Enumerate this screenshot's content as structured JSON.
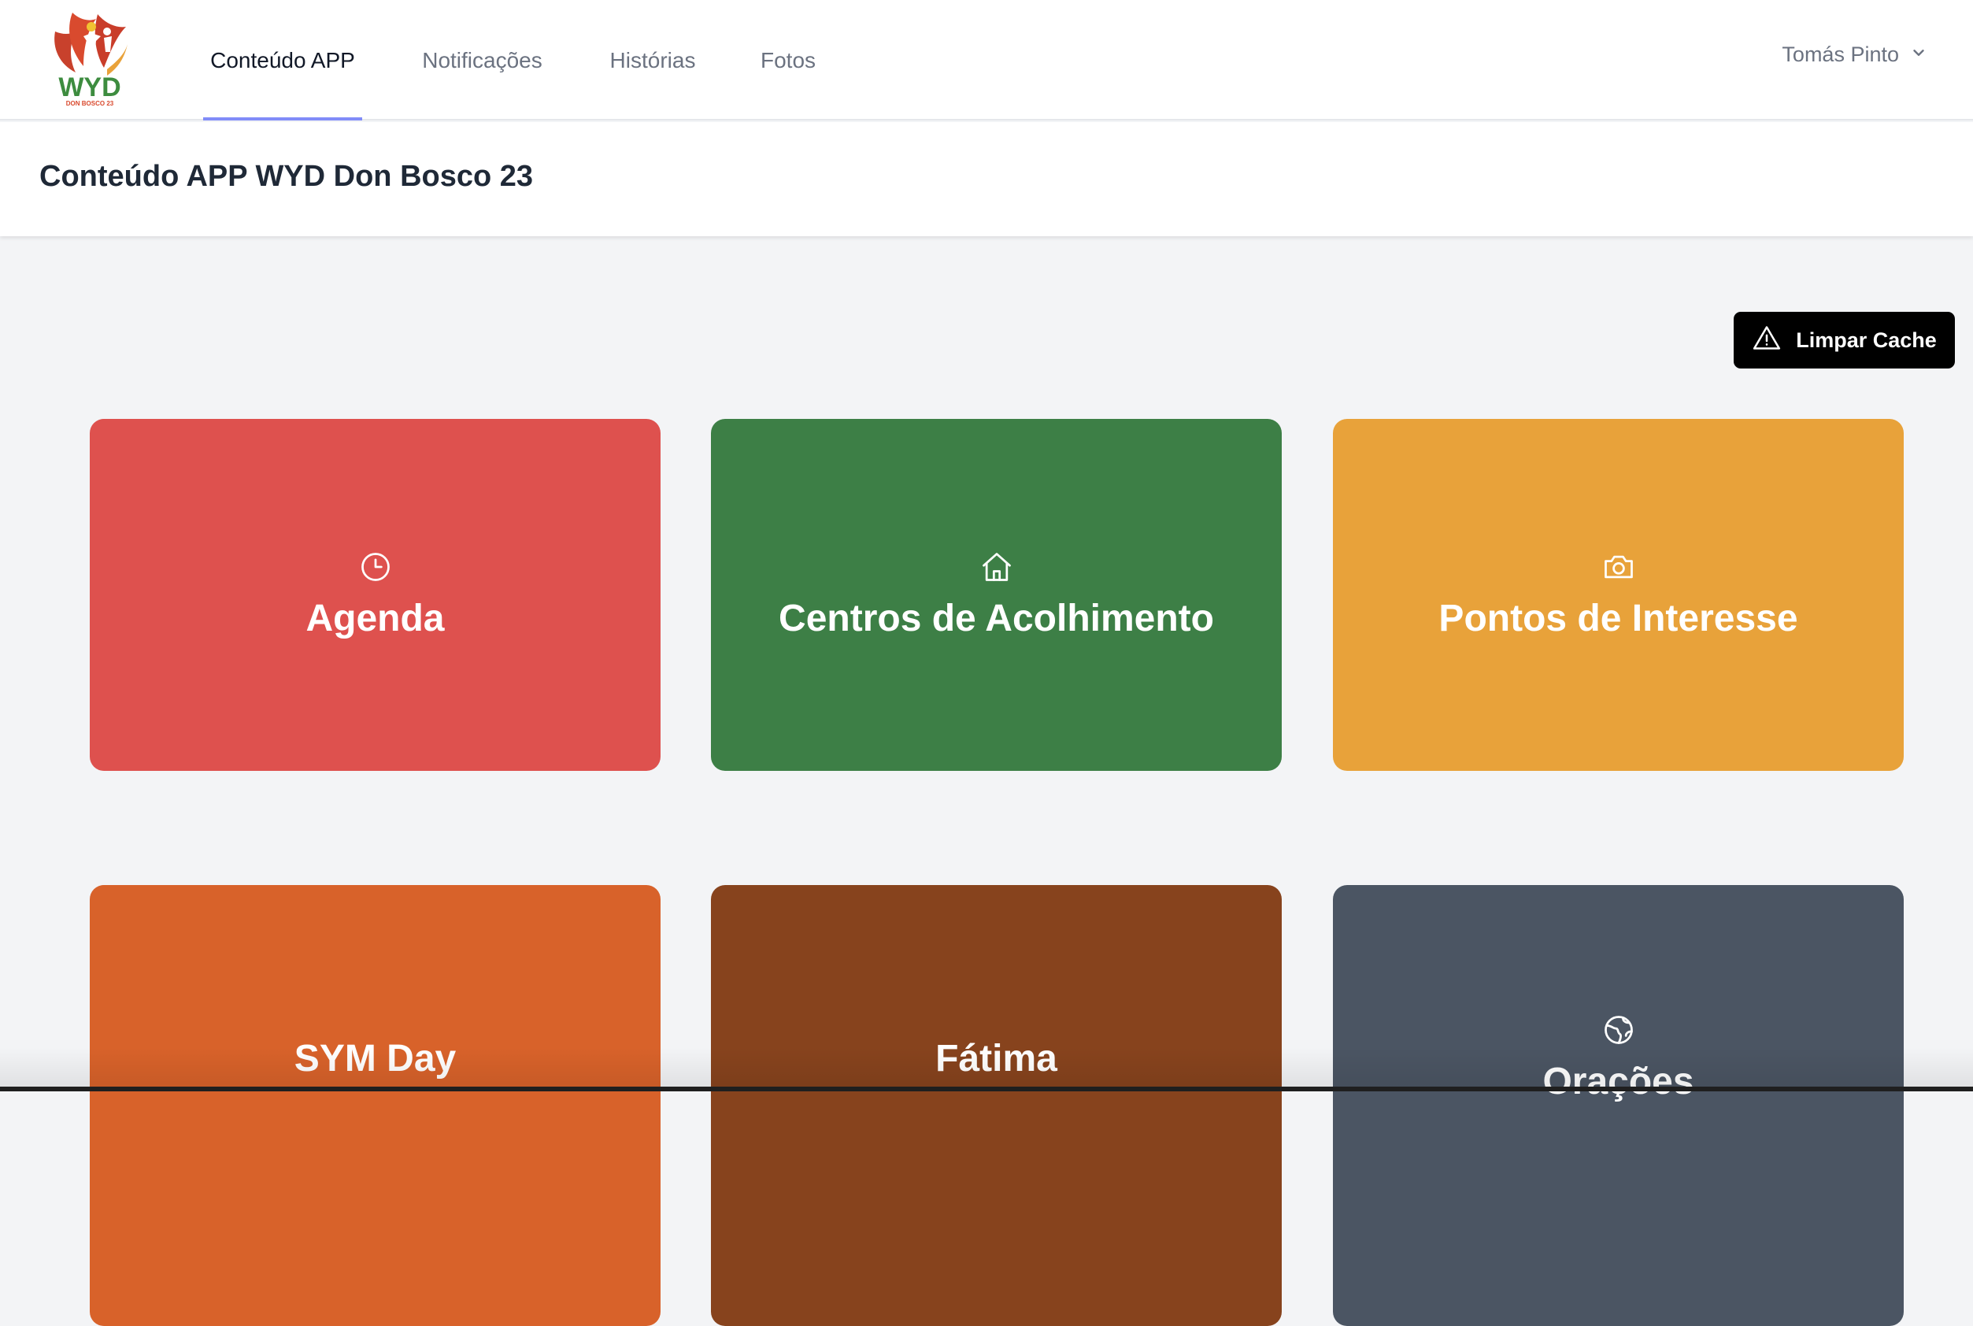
{
  "nav": {
    "logo_text": "WYD",
    "logo_subtext": "DON BOSCO 23",
    "items": [
      {
        "label": "Conteúdo APP",
        "active": true
      },
      {
        "label": "Notificações",
        "active": false
      },
      {
        "label": "Histórias",
        "active": false
      },
      {
        "label": "Fotos",
        "active": false
      }
    ],
    "user": {
      "name": "Tomás Pinto",
      "icon": "chevron-down-icon"
    }
  },
  "header": {
    "title": "Conteúdo APP WYD Don Bosco 23"
  },
  "actions": {
    "clear_cache_label": "Limpar Cache",
    "clear_cache_icon": "warning-triangle-icon"
  },
  "cards": [
    {
      "label": "Agenda",
      "icon": "clock-icon",
      "color": "#de514e"
    },
    {
      "label": "Centros de Acolhimento",
      "icon": "home-icon",
      "color": "#3d7f46"
    },
    {
      "label": "Pontos de Interesse",
      "icon": "camera-icon",
      "color": "#e8a23a"
    },
    {
      "label": "SYM Day",
      "icon": null,
      "color": "#d8622a"
    },
    {
      "label": "Fátima",
      "icon": null,
      "color": "#87431d"
    },
    {
      "label": "Orações",
      "icon": "globe-icon",
      "color": "#4b5563"
    }
  ]
}
